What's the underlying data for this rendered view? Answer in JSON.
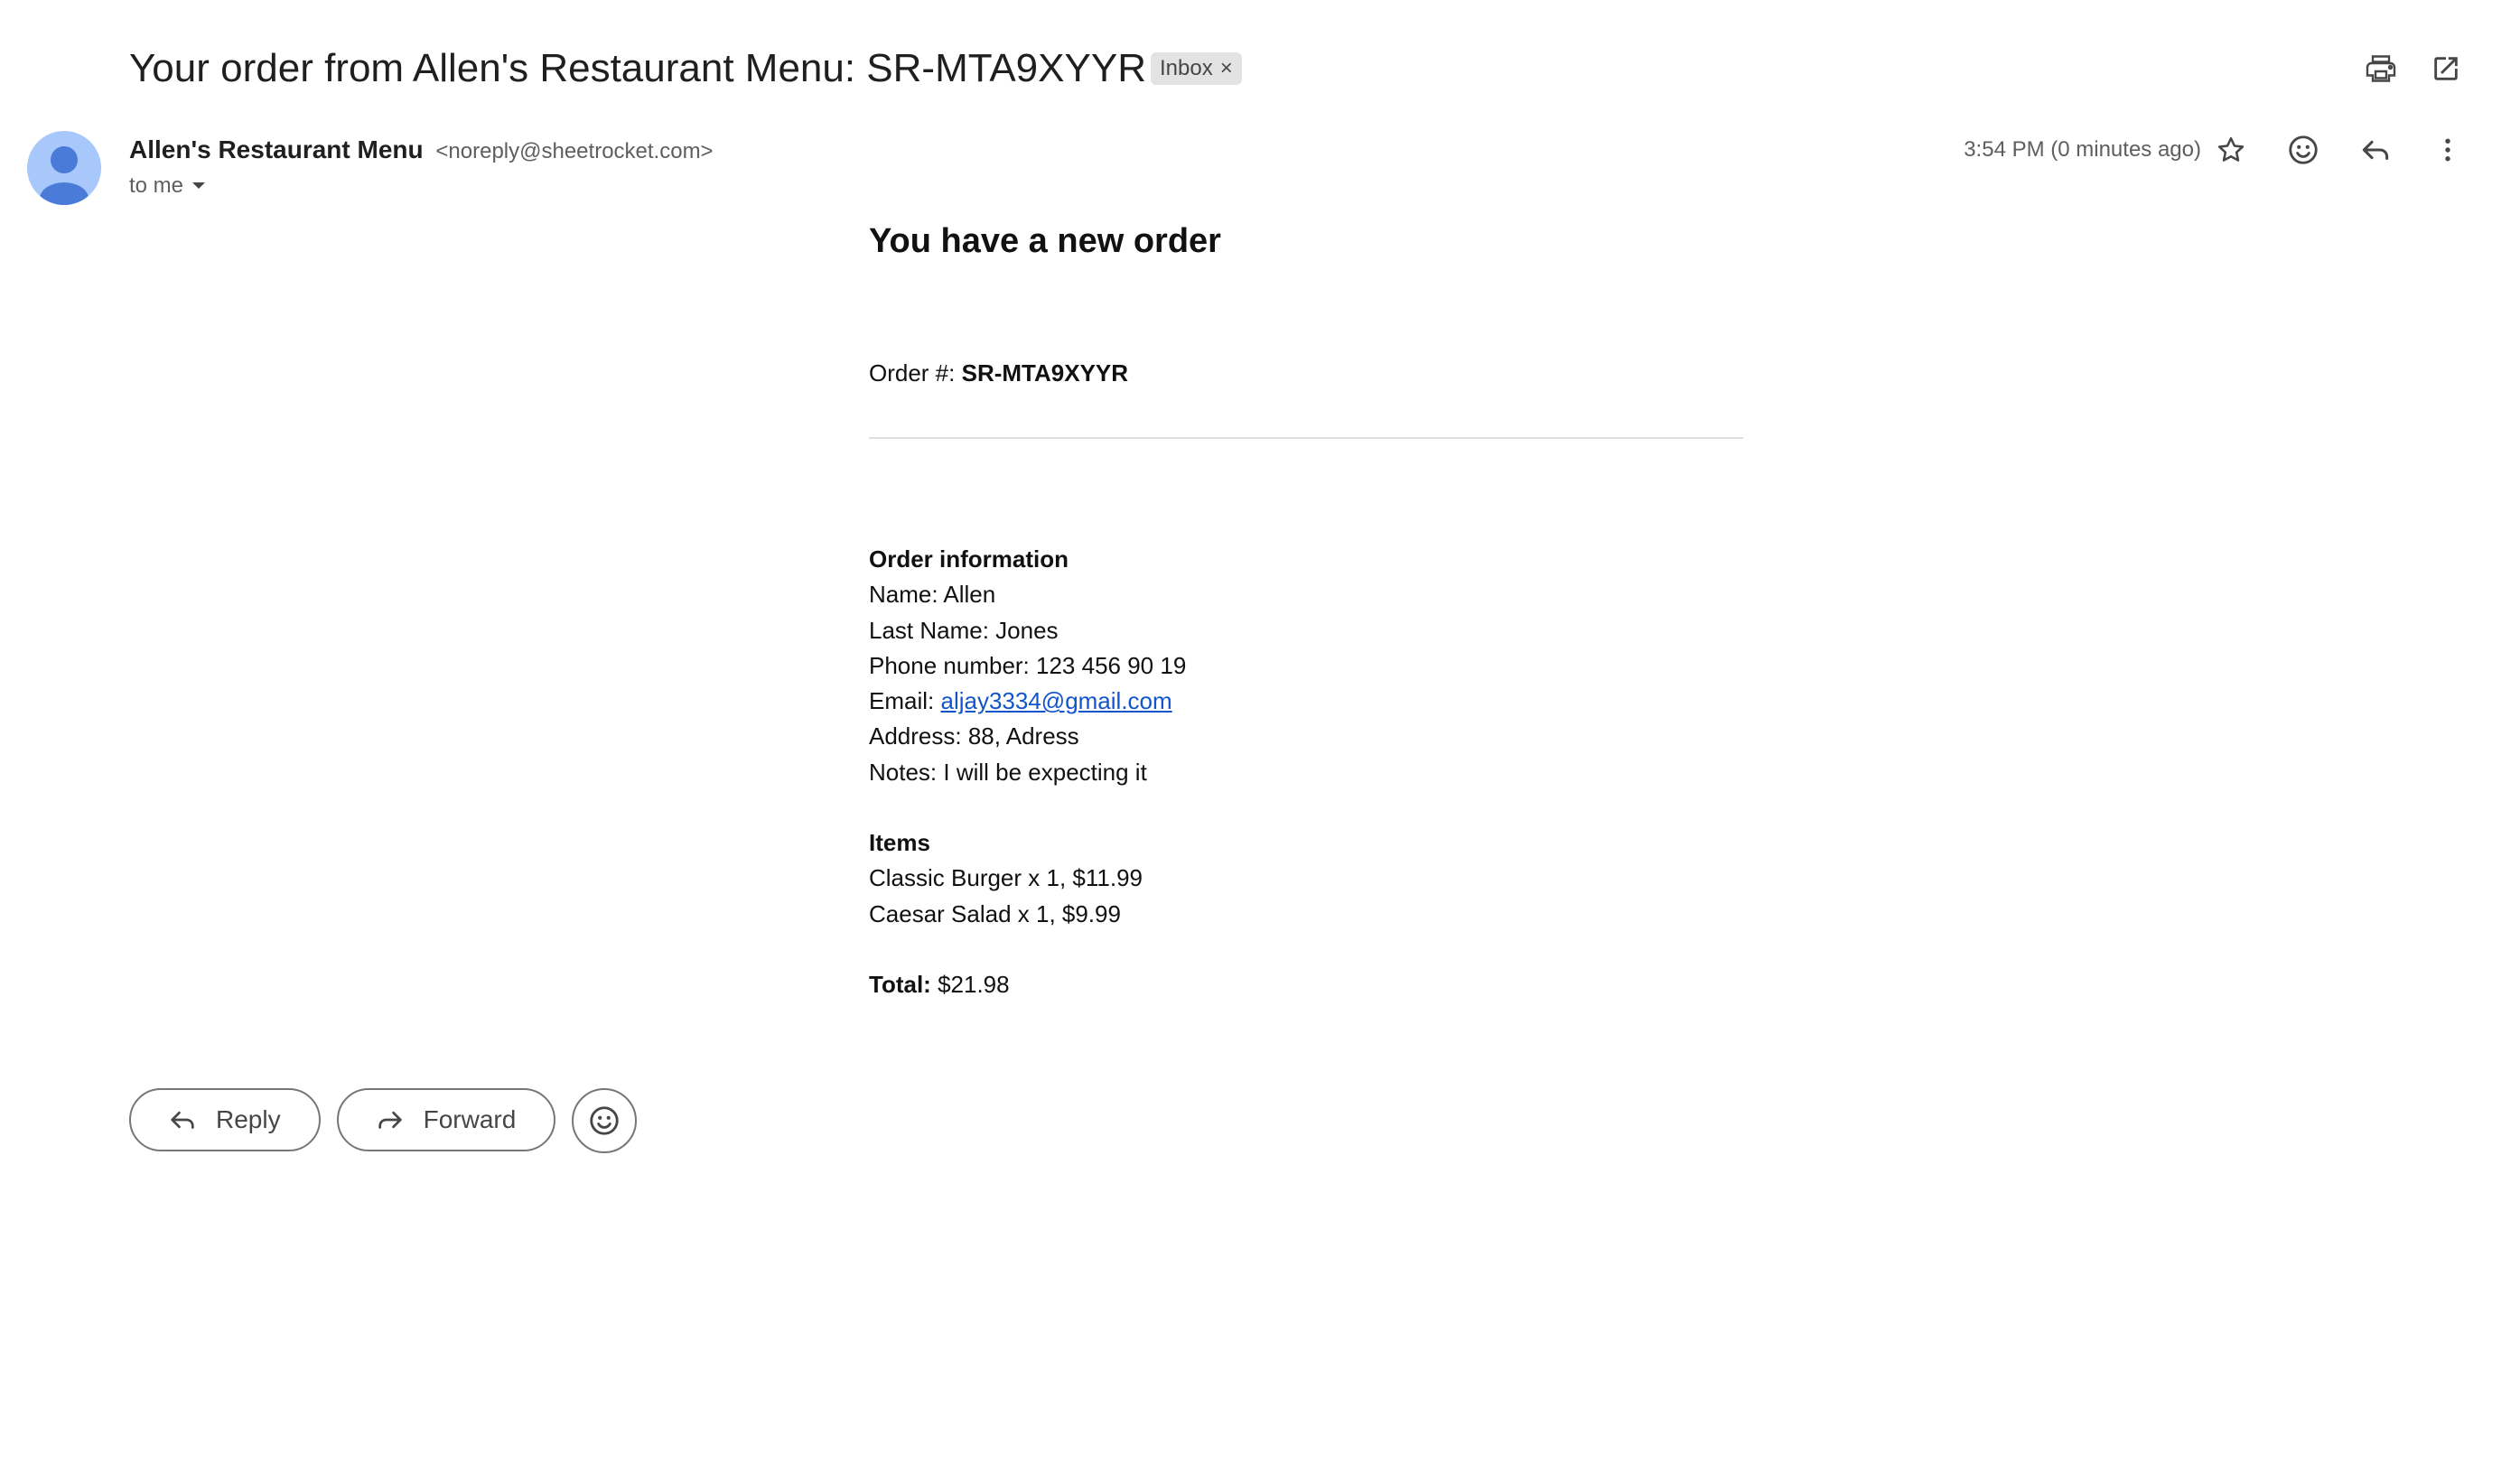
{
  "message": {
    "subject": "Your order from Allen's Restaurant Menu: SR-MTA9XYYR",
    "label_chip": "Inbox",
    "label_remove": "×"
  },
  "toolbar": {
    "print_icon": "print-icon",
    "open_new_window_icon": "open-in-new-icon"
  },
  "header": {
    "sender_name": "Allen's Restaurant Menu",
    "sender_email": "<noreply@sheetrocket.com>",
    "recipient": "to me",
    "timestamp": "3:54 PM (0 minutes ago)",
    "icons": [
      "star-icon",
      "emoji-icon",
      "reply-icon",
      "more-vert-icon"
    ]
  },
  "email_body": {
    "heading": "You have a new order",
    "order_number_label": "Order #:",
    "order_number": "SR-MTA9XYYR",
    "order_info_title": "Order information",
    "name": "Name: Allen",
    "last_name": "Last Name: Jones",
    "phone": "Phone number: 123 456 90 19",
    "email_label": "Email:",
    "email_value": "aljay3334@gmail.com",
    "address": "Address: 88, Adress",
    "notes": "Notes: I will be expecting it",
    "items_title": "Items",
    "items": [
      "Classic Burger x 1, $11.99",
      "Caesar Salad x 1, $9.99"
    ],
    "total_label": "Total:",
    "total_value": "$21.98"
  },
  "actions": {
    "reply_label": "Reply",
    "forward_label": "Forward"
  },
  "colors": {
    "link": "#1155cc",
    "avatar_bg": "#a8c7fa",
    "avatar_fg": "#4b7bd8",
    "chip_bg": "#e3e3e3"
  }
}
